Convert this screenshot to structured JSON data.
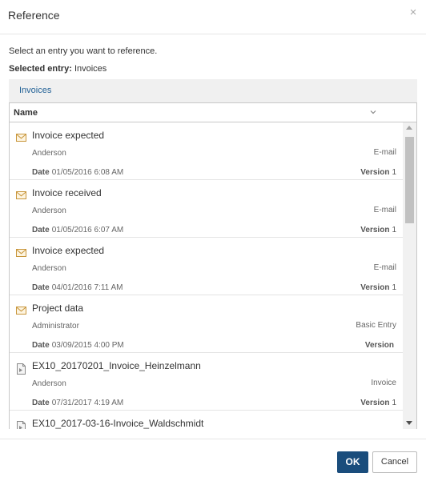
{
  "dialog": {
    "title": "Reference",
    "close_glyph": "×"
  },
  "instruction": "Select an entry you want to reference.",
  "selected": {
    "label": "Selected entry:",
    "value": "Invoices"
  },
  "breadcrumb": {
    "item": "Invoices"
  },
  "column": {
    "name": "Name"
  },
  "items": [
    {
      "name": "Invoice expected",
      "author": "Anderson",
      "type": "E-mail",
      "date_label": "Date",
      "date": "01/05/2016 6:08 AM",
      "version_label": "Version",
      "version": "1",
      "icon": "mail-icon"
    },
    {
      "name": "Invoice received",
      "author": "Anderson",
      "type": "E-mail",
      "date_label": "Date",
      "date": "01/05/2016 6:07 AM",
      "version_label": "Version",
      "version": "1",
      "icon": "mail-icon"
    },
    {
      "name": "Invoice expected",
      "author": "Anderson",
      "type": "E-mail",
      "date_label": "Date",
      "date": "04/01/2016 7:11 AM",
      "version_label": "Version",
      "version": "1",
      "icon": "mail-icon"
    },
    {
      "name": "Project data",
      "author": "Administrator",
      "type": "Basic Entry",
      "date_label": "Date",
      "date": "03/09/2015 4:00 PM",
      "version_label": "Version",
      "version": "",
      "icon": "mail-icon"
    },
    {
      "name": "EX10_20170201_Invoice_Heinzelmann",
      "author": "Anderson",
      "type": "Invoice",
      "date_label": "Date",
      "date": "07/31/2017 4:19 AM",
      "version_label": "Version",
      "version": "1",
      "icon": "document-icon"
    },
    {
      "name": "EX10_2017-03-16-Invoice_Waldschmidt",
      "author": "",
      "type": "",
      "date_label": "",
      "date": "",
      "version_label": "",
      "version": "",
      "icon": "document-icon"
    }
  ],
  "buttons": {
    "ok": "OK",
    "cancel": "Cancel"
  },
  "colors": {
    "primary": "#1a4d7c",
    "link": "#1f5f95",
    "mail_icon": "#c8963c"
  }
}
